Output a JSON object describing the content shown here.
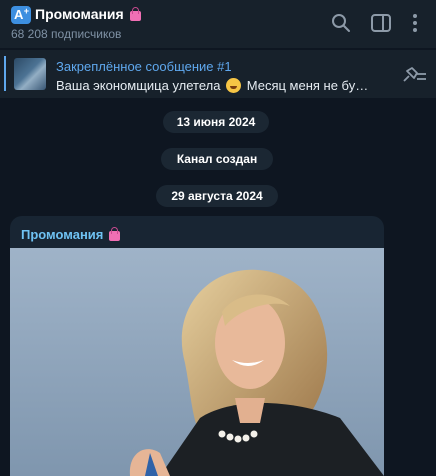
{
  "header": {
    "app_icon_letter": "A",
    "app_icon_plus": "+",
    "title": "Промомания",
    "subscribers": "68 208 подписчиков"
  },
  "pinned": {
    "title": "Закреплённое сообщение #1",
    "text_before_emoji": "Ваша экономщица улетела",
    "text_after_emoji": "Месяц меня не бу…"
  },
  "timeline": {
    "date1": "13 июня 2024",
    "service": "Канал создан",
    "date2": "29 августа 2024"
  },
  "post": {
    "author": "Промомания"
  },
  "colors": {
    "background": "#0e1621",
    "header": "#17212b",
    "accent": "#5fa8ee",
    "author": "#6fc2f3"
  },
  "icons": [
    "app-logo-icon",
    "shopping-bag-icon",
    "search-icon",
    "sidebar-toggle-icon",
    "more-icon",
    "unpin-icon",
    "laughing-emoji-icon"
  ]
}
